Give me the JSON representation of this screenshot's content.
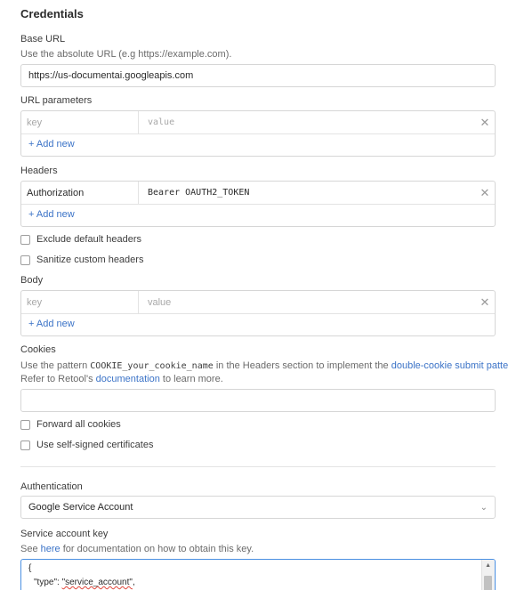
{
  "section_title": "Credentials",
  "base_url": {
    "label": "Base URL",
    "hint": "Use the absolute URL (e.g https://example.com).",
    "value": "https://us-documentai.googleapis.com"
  },
  "url_params": {
    "label": "URL parameters",
    "rows": [
      {
        "key_placeholder": "key",
        "value_placeholder": "value"
      }
    ],
    "add_label": "+ Add new"
  },
  "headers": {
    "label": "Headers",
    "rows": [
      {
        "key": "Authorization",
        "value": "Bearer OAUTH2_TOKEN"
      }
    ],
    "add_label": "+ Add new"
  },
  "checkboxes": {
    "exclude_default": "Exclude default headers",
    "sanitize_custom": "Sanitize custom headers",
    "forward_cookies": "Forward all cookies",
    "self_signed": "Use self-signed certificates"
  },
  "body": {
    "label": "Body",
    "rows": [
      {
        "key_placeholder": "key",
        "value_placeholder": "value"
      }
    ],
    "add_label": "+ Add new"
  },
  "cookies": {
    "label": "Cookies",
    "hint_part1": "Use the pattern",
    "hint_code": "COOKIE_your_cookie_name",
    "hint_part2": "in the Headers section to implement the",
    "hint_link1": "double-cookie submit pattern",
    "hint_part3": ".",
    "hint_line2_part1": "Refer to Retool's",
    "hint_link2": "documentation",
    "hint_line2_part2": "to learn more.",
    "value": ""
  },
  "authentication": {
    "label": "Authentication",
    "selected": "Google Service Account"
  },
  "service_key": {
    "label": "Service account key",
    "hint_part1": "See",
    "hint_link": "here",
    "hint_part2": "for documentation on how to obtain this key.",
    "line1": "{",
    "line2_key": "\"type\": ",
    "line2_value": "\"service_account\"",
    "line2_end": ","
  },
  "icons": {
    "remove": "close-icon",
    "select": "chevron-down-icon",
    "scroll_up": "arrow-up-icon"
  }
}
